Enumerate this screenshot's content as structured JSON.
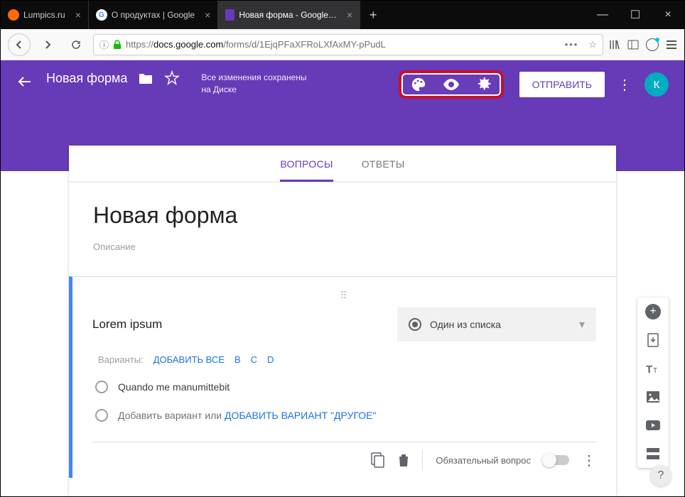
{
  "browser": {
    "tabs": [
      {
        "title": "Lumpics.ru",
        "favicon_color": "#ff6b00"
      },
      {
        "title": "О продуктах | Google",
        "favicon_letter": "G"
      },
      {
        "title": "Новая форма - Google Формы",
        "favicon_color": "#673ab7"
      }
    ],
    "url_prefix": "https://",
    "url_host": "docs.google.com",
    "url_path": "/forms/d/1EjqPFaXFRoLXfAxMY-pPudL"
  },
  "header": {
    "form_name": "Новая форма",
    "save_status_l1": "Все изменения сохранены",
    "save_status_l2": "на Диске",
    "send_label": "ОТПРАВИТЬ",
    "avatar_letter": "К"
  },
  "tabs": {
    "questions": "ВОПРОСЫ",
    "answers": "ОТВЕТЫ"
  },
  "form": {
    "title": "Новая форма",
    "description_placeholder": "Описание"
  },
  "question": {
    "title": "Lorem ipsum",
    "type_label": "Один из списка",
    "variants_label": "Варианты:",
    "add_all": "ДОБАВИТЬ ВСЕ",
    "variant_b": "B",
    "variant_c": "C",
    "variant_d": "D",
    "option1": "Quando me manumittebit",
    "add_option": "Добавить вариант",
    "or": " или ",
    "add_other": "ДОБАВИТЬ ВАРИАНТ \"ДРУГОЕ\"",
    "required_label": "Обязательный вопрос"
  }
}
